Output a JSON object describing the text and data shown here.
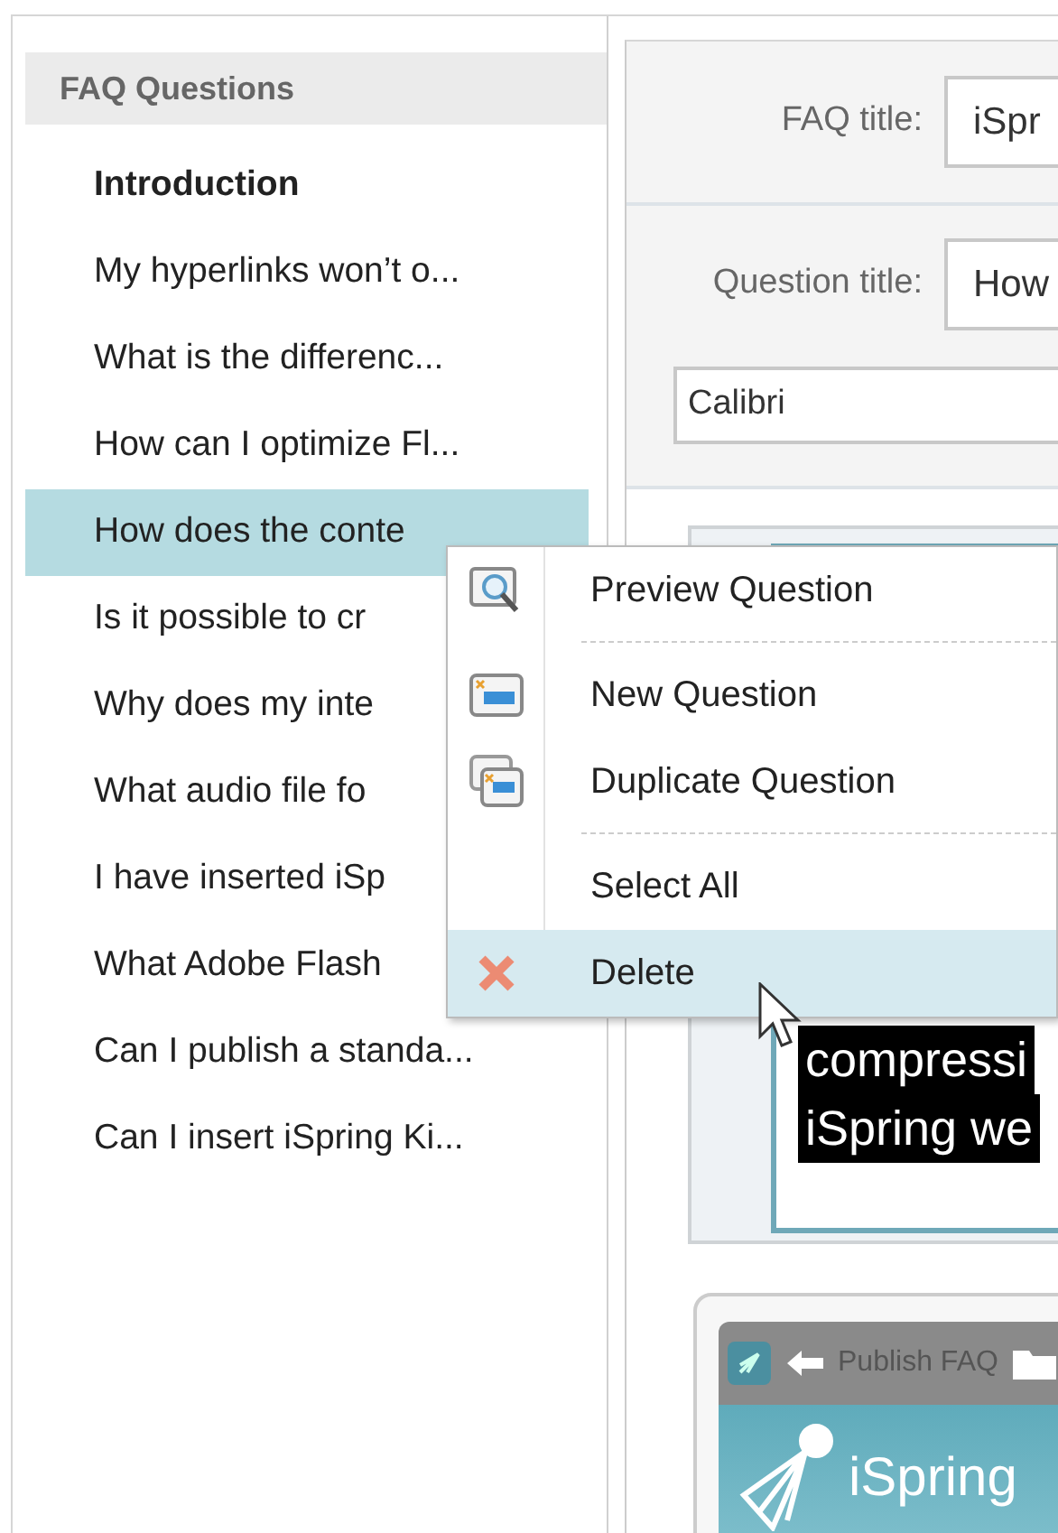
{
  "sidebar": {
    "title": "FAQ Questions",
    "items": [
      {
        "text": "Introduction",
        "kind": "section",
        "selected": false
      },
      {
        "text": "My hyperlinks won’t o...",
        "kind": "question",
        "selected": false
      },
      {
        "text": "What is the differenc...",
        "kind": "question",
        "selected": false
      },
      {
        "text": "How can I optimize Fl...",
        "kind": "question",
        "selected": false
      },
      {
        "text": "How does the conte",
        "kind": "question",
        "selected": true
      },
      {
        "text": "Is it possible to cr",
        "kind": "question",
        "selected": false
      },
      {
        "text": "Why does my inte",
        "kind": "question",
        "selected": false
      },
      {
        "text": "What audio file fo",
        "kind": "question",
        "selected": false
      },
      {
        "text": "I have inserted iSp",
        "kind": "question",
        "selected": false
      },
      {
        "text": "What Adobe Flash",
        "kind": "question",
        "selected": false
      },
      {
        "text": "Can I publish a standa...",
        "kind": "question",
        "selected": false
      },
      {
        "text": "Can I insert iSpring Ki...",
        "kind": "question",
        "selected": false
      }
    ]
  },
  "form": {
    "faq_title": {
      "label": "FAQ title:",
      "value": "iSpr"
    },
    "question_title": {
      "label": "Question title:",
      "value": "How"
    },
    "font": {
      "value": "Calibri"
    }
  },
  "editor": {
    "lines": [
      "compressi",
      "iSpring we"
    ]
  },
  "preview": {
    "title": "Publish FAQ",
    "logo_text": "iSpring"
  },
  "context_menu": {
    "items": [
      {
        "kind": "preview",
        "label": "Preview Question",
        "highlighted": false
      },
      {
        "kind": "separator"
      },
      {
        "kind": "new",
        "label": "New Question",
        "highlighted": false
      },
      {
        "kind": "duplicate",
        "label": "Duplicate Question",
        "highlighted": false
      },
      {
        "kind": "separator"
      },
      {
        "kind": "plain",
        "label": "Select All",
        "highlighted": false
      },
      {
        "kind": "delete",
        "label": "Delete",
        "highlighted": true
      }
    ]
  }
}
